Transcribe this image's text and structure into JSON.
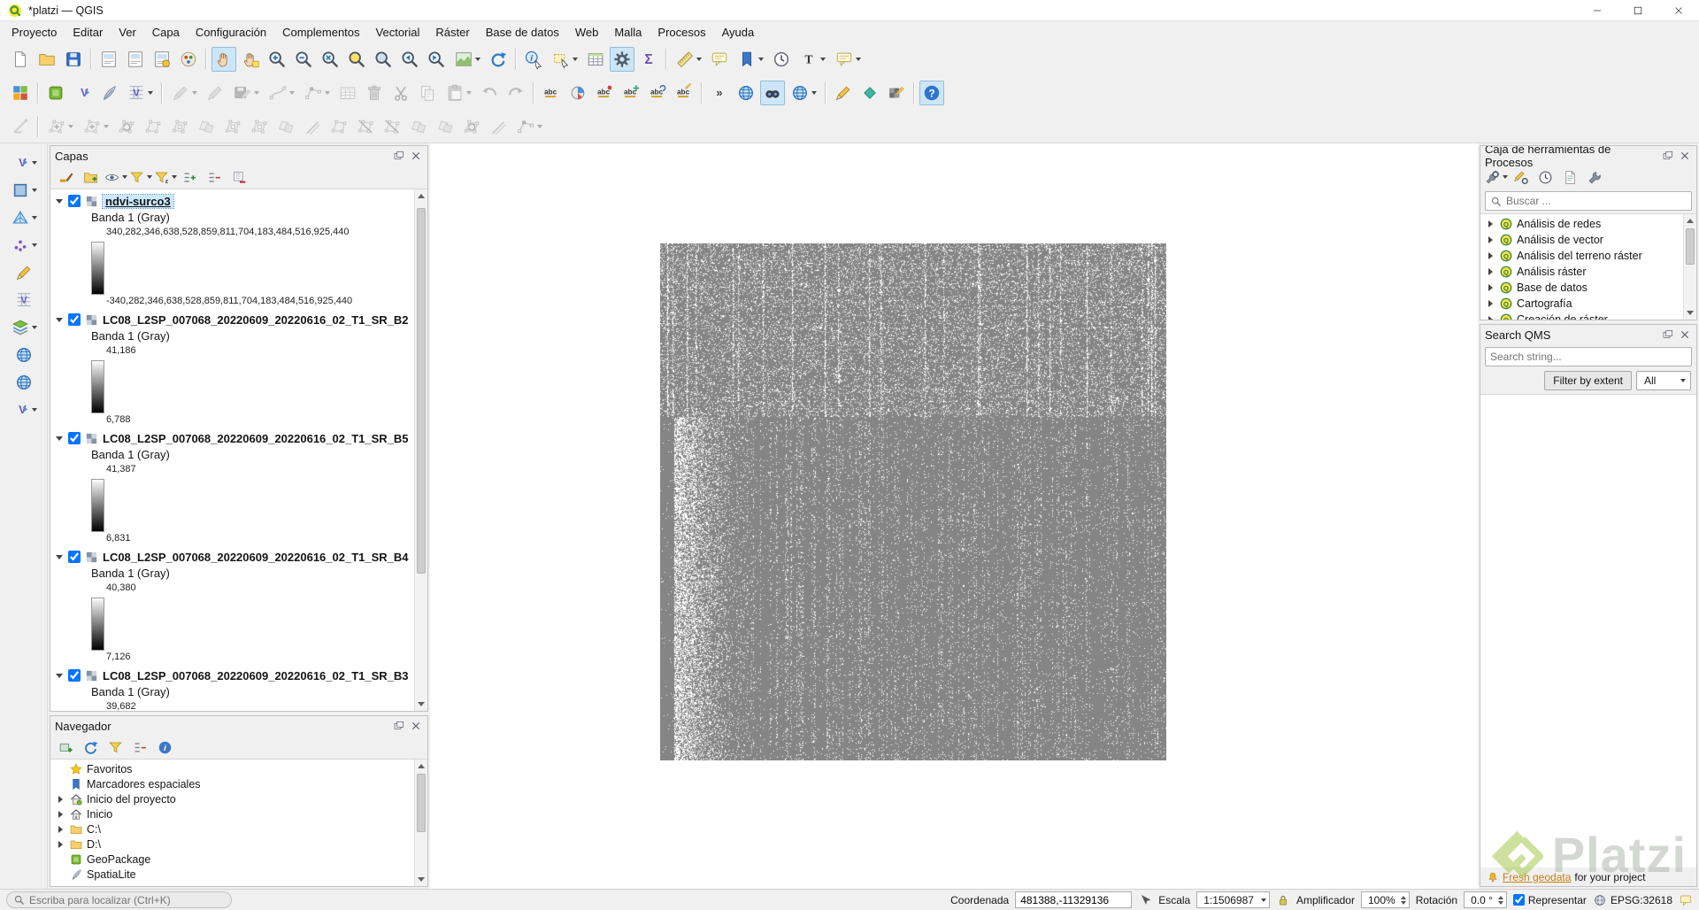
{
  "window": {
    "title": "*platzi — QGIS"
  },
  "menubar": [
    "Proyecto",
    "Editar",
    "Ver",
    "Capa",
    "Configuración",
    "Complementos",
    "Vectorial",
    "Ráster",
    "Base de datos",
    "Web",
    "Malla",
    "Procesos",
    "Ayuda"
  ],
  "toolbars": {
    "row1": [
      {
        "name": "new-project",
        "kind": "page"
      },
      {
        "name": "open-project",
        "kind": "folder"
      },
      {
        "name": "save-project",
        "kind": "floppy"
      },
      {
        "sep": true
      },
      {
        "name": "new-print-layout",
        "kind": "layout"
      },
      {
        "name": "new-report",
        "kind": "layout"
      },
      {
        "name": "layout-manager",
        "kind": "layout-mgr"
      },
      {
        "name": "style-manager",
        "kind": "palette"
      },
      {
        "sep": true
      },
      {
        "name": "pan-map",
        "kind": "hand",
        "active": true
      },
      {
        "name": "pan-to-selection",
        "kind": "hand-sel"
      },
      {
        "name": "zoom-in",
        "kind": "mag-plus"
      },
      {
        "name": "zoom-out",
        "kind": "mag-minus"
      },
      {
        "name": "zoom-full",
        "kind": "mag-full"
      },
      {
        "name": "zoom-to-selection",
        "kind": "mag-sel"
      },
      {
        "name": "zoom-to-layer",
        "kind": "mag-layer"
      },
      {
        "name": "zoom-last",
        "kind": "mag-prev"
      },
      {
        "name": "zoom-next",
        "kind": "mag-next"
      },
      {
        "name": "new-map-view",
        "kind": "mapview",
        "dd": true
      },
      {
        "name": "refresh-map",
        "kind": "refresh"
      },
      {
        "sep": true
      },
      {
        "name": "identify-features",
        "kind": "identify"
      },
      {
        "name": "select-features",
        "kind": "select",
        "dd": true
      },
      {
        "name": "open-attribute-table",
        "kind": "table"
      },
      {
        "name": "processing-toolbox",
        "kind": "gear",
        "active": true
      },
      {
        "name": "statistical-summary",
        "kind": "sigma"
      },
      {
        "sep": true
      },
      {
        "name": "measure",
        "kind": "ruler",
        "dd": true
      },
      {
        "name": "map-tips",
        "kind": "balloon"
      },
      {
        "name": "new-spatial-bookmark",
        "kind": "bookmark",
        "dd": true
      },
      {
        "name": "temporal-controller",
        "kind": "clock"
      },
      {
        "name": "text-annotation",
        "kind": "textT",
        "dd": true
      },
      {
        "name": "form-annotation",
        "kind": "balloon",
        "dd": true
      }
    ],
    "row2": [
      {
        "name": "open-data-source-manager",
        "kind": "grid-colored"
      },
      {
        "sep": true
      },
      {
        "name": "new-geopackage-layer",
        "kind": "cube-green"
      },
      {
        "name": "new-shapefile-layer",
        "kind": "vfile"
      },
      {
        "name": "new-spatialite-layer",
        "kind": "feather"
      },
      {
        "name": "new-virtual-layer",
        "kind": "vgrid",
        "dd": true
      },
      {
        "sep": true
      },
      {
        "name": "current-edits",
        "kind": "pencil",
        "dd": true,
        "disabled": true
      },
      {
        "name": "toggle-editing",
        "kind": "pencil",
        "disabled": true
      },
      {
        "name": "save-layer-edits",
        "kind": "floppy-pencil",
        "dd": true,
        "disabled": true
      },
      {
        "name": "digitize-with-curve",
        "kind": "node-line",
        "dd": true,
        "disabled": true
      },
      {
        "name": "vertex-tool",
        "kind": "gpoly-nodes",
        "dd": true,
        "disabled": true
      },
      {
        "name": "modify-attributes",
        "kind": "table",
        "disabled": true
      },
      {
        "name": "delete-selected",
        "kind": "trash",
        "disabled": true
      },
      {
        "name": "cut-features",
        "kind": "scissors",
        "disabled": true
      },
      {
        "name": "copy-features",
        "kind": "copy",
        "disabled": true
      },
      {
        "name": "paste-features",
        "kind": "paste",
        "dd": true,
        "disabled": true
      },
      {
        "name": "undo",
        "kind": "undo",
        "disabled": true
      },
      {
        "name": "redo",
        "kind": "redo",
        "disabled": true
      },
      {
        "sep": true
      },
      {
        "name": "layer-labeling",
        "kind": "abc"
      },
      {
        "name": "layer-diagram",
        "kind": "diagram"
      },
      {
        "name": "highlight-pinned-labels",
        "kind": "abc-pin"
      },
      {
        "name": "move-label",
        "kind": "abc-move"
      },
      {
        "name": "rotate-label",
        "kind": "abc-rot"
      },
      {
        "name": "change-label",
        "kind": "abc-edit"
      },
      {
        "sep": true
      },
      {
        "name": "toolbar-overflow",
        "kind": "chevrons"
      },
      {
        "name": "osm-place-search",
        "kind": "globe"
      },
      {
        "name": "search-qms",
        "kind": "binoculars",
        "active": true
      },
      {
        "name": "quickmapservices",
        "kind": "globe",
        "dd": true
      },
      {
        "sep": true
      },
      {
        "name": "digitize-sketch",
        "kind": "pencil"
      },
      {
        "name": "geometry-checker",
        "kind": "diamond"
      },
      {
        "name": "serval-raster-tools",
        "kind": "raster-pencil"
      },
      {
        "sep": true
      },
      {
        "name": "help-contents",
        "kind": "question",
        "active": true
      }
    ],
    "row3": [
      {
        "name": "enable-advanced-digitizing",
        "kind": "cad",
        "disabled": true
      },
      {
        "sep": true
      },
      {
        "name": "move-feature",
        "kind": "gpoly-move",
        "dd": true,
        "disabled": true
      },
      {
        "name": "copy-move-feature",
        "kind": "gpoly-move",
        "dd": true,
        "disabled": true
      },
      {
        "name": "rotate-feature",
        "kind": "gpoly-rotate",
        "disabled": true
      },
      {
        "name": "simplify-feature",
        "kind": "gpoly",
        "disabled": true
      },
      {
        "name": "add-ring",
        "kind": "gpoly-ring",
        "disabled": true
      },
      {
        "name": "add-part",
        "kind": "gpoly-merge",
        "disabled": true
      },
      {
        "name": "fill-ring",
        "kind": "gpoly-ring",
        "disabled": true
      },
      {
        "name": "delete-ring",
        "kind": "gpoly-ring",
        "disabled": true
      },
      {
        "name": "delete-part",
        "kind": "gpoly-merge",
        "disabled": true
      },
      {
        "name": "offset-curve",
        "kind": "gpoly-offset",
        "disabled": true
      },
      {
        "name": "reshape-features",
        "kind": "gpoly",
        "disabled": true
      },
      {
        "name": "split-features",
        "kind": "gpoly-split",
        "disabled": true
      },
      {
        "name": "split-parts",
        "kind": "gpoly-split",
        "disabled": true
      },
      {
        "name": "merge-features",
        "kind": "gpoly-merge",
        "disabled": true
      },
      {
        "name": "merge-attributes",
        "kind": "gpoly-merge",
        "disabled": true
      },
      {
        "name": "rotate-point-symbols",
        "kind": "gpoly-rotate",
        "disabled": true
      },
      {
        "name": "offset-point-symbol",
        "kind": "gpoly-offset",
        "disabled": true
      },
      {
        "name": "trim-extend",
        "kind": "gpoly-nodes",
        "dd": true,
        "disabled": true
      }
    ],
    "left": [
      {
        "name": "shape-digitizing",
        "kind": "vfile",
        "dd": true
      },
      {
        "name": "add-rectangle",
        "kind": "bluesq",
        "dd": true
      },
      {
        "name": "mesh-digitizing",
        "kind": "mesh",
        "dd": true
      },
      {
        "name": "point-cloud",
        "kind": "dots",
        "dd": true
      },
      {
        "name": "annotation-tool",
        "kind": "pencil"
      },
      {
        "name": "virtual-layer-tool",
        "kind": "vgrid"
      },
      {
        "name": "layer-stack-tool",
        "kind": "layers",
        "dd": true
      },
      {
        "name": "wms-service",
        "kind": "globe"
      },
      {
        "name": "wfs-service",
        "kind": "globe"
      },
      {
        "name": "vector-tools",
        "kind": "vfile",
        "dd": true
      }
    ]
  },
  "layers_panel": {
    "title": "Capas",
    "toolbar": [
      {
        "name": "open-layer-styling",
        "kind": "brush"
      },
      {
        "name": "add-group",
        "kind": "folder-plus"
      },
      {
        "name": "manage-map-themes",
        "kind": "eye",
        "dd": true
      },
      {
        "name": "filter-legend",
        "kind": "funnel",
        "dd": true
      },
      {
        "name": "filter-by-expression",
        "kind": "funnel-e",
        "dd": true
      },
      {
        "name": "expand-all",
        "kind": "expand"
      },
      {
        "name": "collapse-all",
        "kind": "collapse"
      },
      {
        "name": "remove-layer",
        "kind": "remove"
      }
    ],
    "layers": [
      {
        "name": "ndvi-surco3",
        "selected": true,
        "checked": true,
        "band": "Banda 1 (Gray)",
        "max": "340,282,346,638,528,859,811,704,183,484,516,925,440",
        "min": "-340,282,346,638,528,859,811,704,183,484,516,925,440"
      },
      {
        "name": "LC08_L2SP_007068_20220609_20220616_02_T1_SR_B2",
        "selected": false,
        "checked": true,
        "band": "Banda 1 (Gray)",
        "max": "41,186",
        "min": "6,788"
      },
      {
        "name": "LC08_L2SP_007068_20220609_20220616_02_T1_SR_B5",
        "selected": false,
        "checked": true,
        "band": "Banda 1 (Gray)",
        "max": "41,387",
        "min": "6,831"
      },
      {
        "name": "LC08_L2SP_007068_20220609_20220616_02_T1_SR_B4",
        "selected": false,
        "checked": true,
        "band": "Banda 1 (Gray)",
        "max": "40,380",
        "min": "7,126"
      },
      {
        "name": "LC08_L2SP_007068_20220609_20220616_02_T1_SR_B3",
        "selected": false,
        "checked": true,
        "band": "Banda 1 (Gray)",
        "max": "39,682",
        "min": ""
      }
    ]
  },
  "browser_panel": {
    "title": "Navegador",
    "toolbar": [
      {
        "name": "add-selected-layers",
        "kind": "layer-add"
      },
      {
        "name": "refresh-browser",
        "kind": "refresh"
      },
      {
        "name": "filter-browser",
        "kind": "funnel"
      },
      {
        "name": "collapse-browser",
        "kind": "collapse"
      },
      {
        "name": "browser-properties",
        "kind": "info-i"
      }
    ],
    "items": [
      {
        "label": "Favoritos",
        "icon": "star",
        "expandable": false
      },
      {
        "label": "Marcadores espaciales",
        "icon": "bookmark",
        "expandable": false
      },
      {
        "label": "Inicio del proyecto",
        "icon": "home-project",
        "expandable": true
      },
      {
        "label": "Inicio",
        "icon": "home",
        "expandable": true
      },
      {
        "label": "C:\\",
        "icon": "drive",
        "expandable": true
      },
      {
        "label": "D:\\",
        "icon": "drive",
        "expandable": true
      },
      {
        "label": "GeoPackage",
        "icon": "cube-green",
        "expandable": false
      },
      {
        "label": "SpatiaLite",
        "icon": "feather",
        "expandable": false
      }
    ]
  },
  "processing_panel": {
    "title": "Caja de herramientas de Procesos",
    "toolbar": [
      {
        "name": "processing-models",
        "kind": "wrench-gear",
        "dd": true
      },
      {
        "name": "edit-features-in-place",
        "kind": "pencil-gear"
      },
      {
        "name": "processing-history",
        "kind": "clock"
      },
      {
        "name": "results-viewer",
        "kind": "doc"
      },
      {
        "name": "processing-options",
        "kind": "wrench"
      }
    ],
    "search_placeholder": "Buscar ...",
    "groups": [
      "Análisis de redes",
      "Análisis de vector",
      "Análisis del terreno ráster",
      "Análisis ráster",
      "Base de datos",
      "Cartografía",
      "Creación de ráster"
    ]
  },
  "qms_panel": {
    "title": "Search QMS",
    "search_placeholder": "Search string...",
    "filter_button": "Filter by extent",
    "type_filter": "All",
    "footer_link": "Fresh geodata",
    "footer_text": "for your project"
  },
  "statusbar": {
    "locator_placeholder": "Escriba para localizar (Ctrl+K)",
    "coordinate_label": "Coordenada",
    "coordinate_value": "481388,-11329136",
    "scale_label": "Escala",
    "scale_value": "1:1506987",
    "magnifier_label": "Amplificador",
    "magnifier_value": "100%",
    "rotation_label": "Rotación",
    "rotation_value": "0.0 °",
    "render_label": "Representar",
    "crs_label": "EPSG:32618"
  },
  "watermark": {
    "text": "Platzi"
  }
}
